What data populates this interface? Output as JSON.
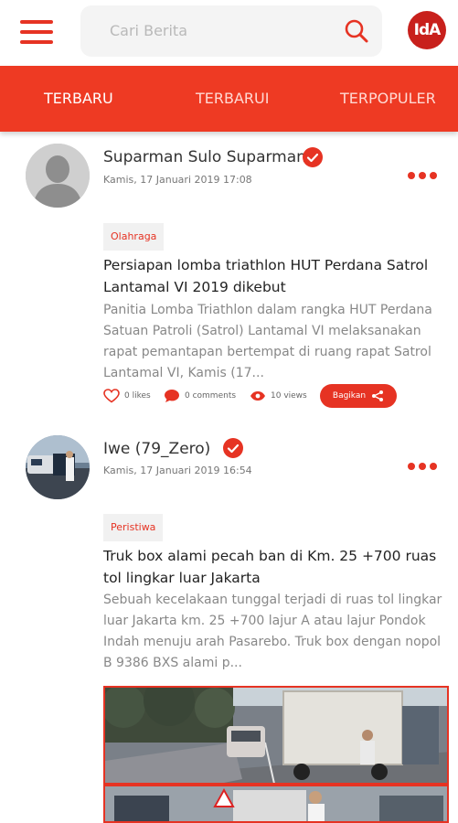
{
  "header": {
    "search_placeholder": "Cari Berita",
    "logo_text": "IdA",
    "icons": {
      "menu": "hamburger-menu-icon",
      "search": "search-icon"
    }
  },
  "tabs": [
    {
      "label": "TERBARU",
      "active": true
    },
    {
      "label": "TERBARUI",
      "active": false
    },
    {
      "label": "TERPOPULER",
      "active": false
    }
  ],
  "posts": [
    {
      "author": "Suparman Sulo Suparman",
      "time": "Kamis, 17 Januari 2019 17:08",
      "category": "Olahraga",
      "title": "Persiapan lomba triathlon HUT Perdana Satrol Lantamal VI 2019 dikebut",
      "excerpt": "Panitia Lomba Triathlon dalam rangka HUT Perdana Satuan Patroli (Satrol) Lantamal VI melaksanakan rapat pemantapan bertempat di ruang rapat Satrol Lantamal VI, Kamis (17...",
      "likes": "0 likes",
      "comments": "0 comments",
      "views": "10 views",
      "share_label": "Bagikan"
    },
    {
      "author": "Iwe (79_Zero)",
      "time": "Kamis, 17 Januari 2019 16:54",
      "category": "Peristiwa",
      "title": "Truk box alami pecah ban di Km. 25 +700 ruas tol lingkar luar Jakarta",
      "excerpt": "Sebuah kecelakaan tunggal terjadi di ruas tol lingkar luar Jakarta km. 25 +700 lajur A atau lajur Pondok Indah menuju arah Pasarebo. Truk box dengan nopol B 9386 BXS alami p..."
    }
  ],
  "colors": {
    "accent": "#e63323",
    "tab_bar": "#ee3a23",
    "logo": "#c8201c"
  }
}
